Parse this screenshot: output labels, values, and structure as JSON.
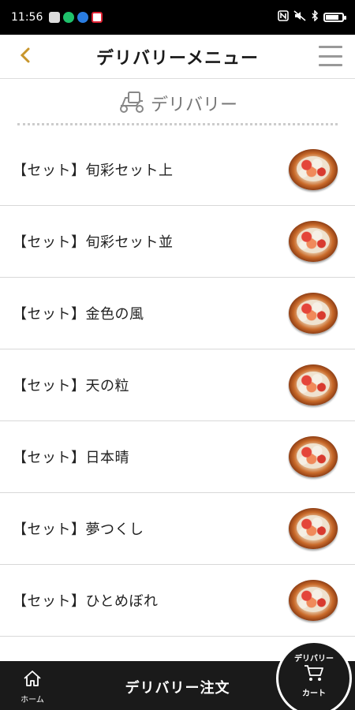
{
  "status_bar": {
    "time": "11:56",
    "battery_level": 0.9
  },
  "header": {
    "title": "デリバリーメニュー",
    "back_icon": "chevron-left-icon",
    "menu_icon": "hamburger-menu-icon"
  },
  "section": {
    "title": "デリバリー",
    "icon": "delivery-scooter-icon"
  },
  "menu_items": [
    {
      "name": "【セット】旬彩セット上"
    },
    {
      "name": "【セット】旬彩セット並"
    },
    {
      "name": "【セット】金色の風"
    },
    {
      "name": "【セット】天の粒"
    },
    {
      "name": "【セット】日本晴"
    },
    {
      "name": "【セット】夢つくし"
    },
    {
      "name": "【セット】ひとめぼれ"
    },
    {
      "name": ""
    }
  ],
  "bottom_bar": {
    "home_label": "ホーム",
    "title": "デリバリー注文",
    "cart_top_label": "デリバリー",
    "cart_bottom_label": "カート"
  },
  "colors": {
    "accent": "#c8962c",
    "bar_background": "#1a1a1a"
  }
}
